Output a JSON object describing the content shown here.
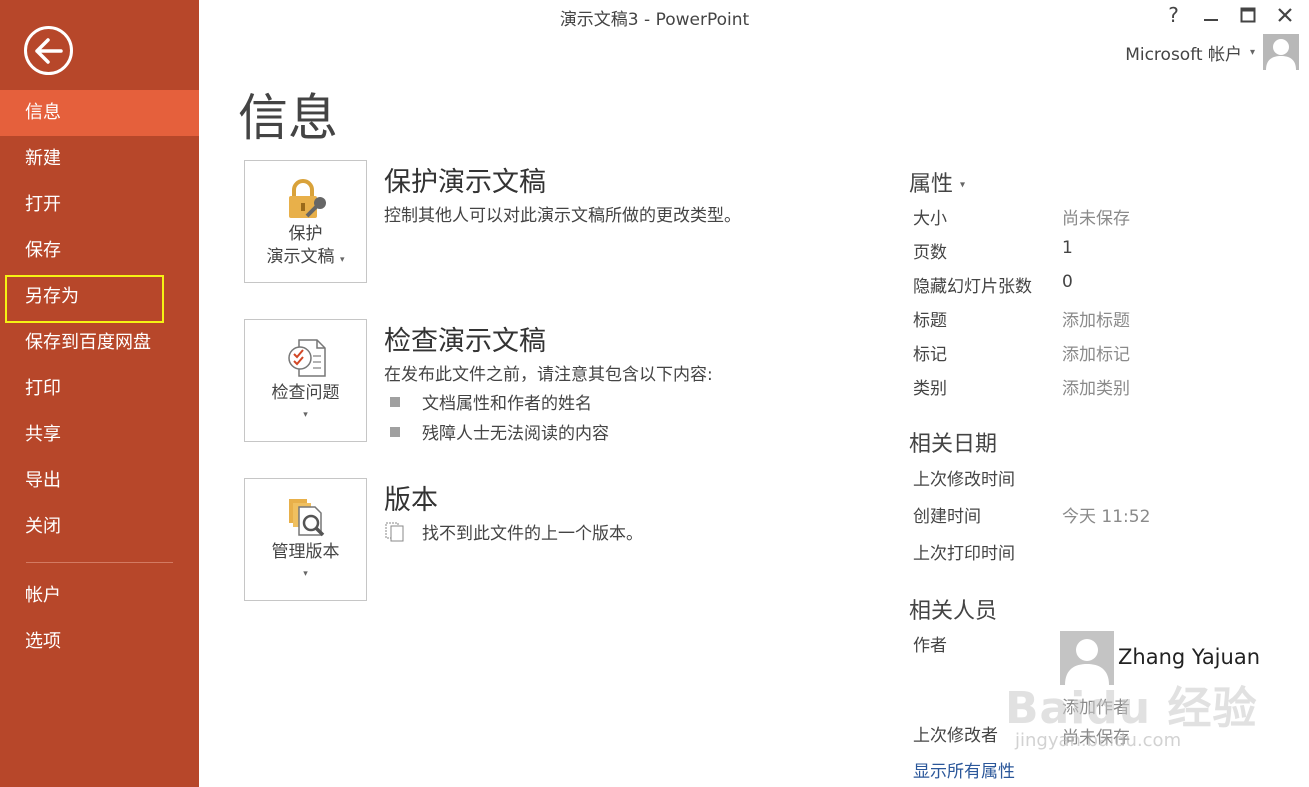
{
  "window": {
    "title": "演示文稿3 - PowerPoint",
    "help": "?",
    "minimize": "—",
    "maximize": "☐",
    "close": "✕"
  },
  "account": {
    "label": "Microsoft 帐户",
    "caret": "▾"
  },
  "sidebar": {
    "items": [
      {
        "label": "信息"
      },
      {
        "label": "新建"
      },
      {
        "label": "打开"
      },
      {
        "label": "保存"
      },
      {
        "label": "另存为"
      },
      {
        "label": "保存到百度网盘"
      },
      {
        "label": "打印"
      },
      {
        "label": "共享"
      },
      {
        "label": "导出"
      },
      {
        "label": "关闭"
      },
      {
        "label": "帐户"
      },
      {
        "label": "选项"
      }
    ],
    "active_index": 0,
    "highlighted_index": 4
  },
  "page": {
    "title": "信息"
  },
  "sections": {
    "protect": {
      "button_line1": "保护",
      "button_line2": "演示文稿",
      "caret": "▾",
      "title": "保护演示文稿",
      "desc": "控制其他人可以对此演示文稿所做的更改类型。"
    },
    "inspect": {
      "button_label": "检查问题",
      "caret": "▾",
      "title": "检查演示文稿",
      "desc": "在发布此文件之前，请注意其包含以下内容:",
      "bullets": [
        "文档属性和作者的姓名",
        "残障人士无法阅读的内容"
      ]
    },
    "versions": {
      "button_label": "管理版本",
      "caret": "▾",
      "title": "版本",
      "desc": "找不到此文件的上一个版本。"
    }
  },
  "properties": {
    "heading": "属性",
    "caret": "▾",
    "rows": [
      {
        "label": "大小",
        "value": "尚未保存"
      },
      {
        "label": "页数",
        "value": "1"
      },
      {
        "label": "隐藏幻灯片张数",
        "value": "0"
      },
      {
        "label": "标题",
        "value": "添加标题"
      },
      {
        "label": "标记",
        "value": "添加标记"
      },
      {
        "label": "类别",
        "value": "添加类别"
      }
    ],
    "dates_heading": "相关日期",
    "dates": [
      {
        "label": "上次修改时间",
        "value": ""
      },
      {
        "label": "创建时间",
        "value": "今天 11:52"
      },
      {
        "label": "上次打印时间",
        "value": ""
      }
    ],
    "people_heading": "相关人员",
    "author_label": "作者",
    "author_name": "Zhang Yajuan",
    "add_author": "添加作者",
    "last_modified_by_label": "上次修改者",
    "last_modified_by_value": "尚未保存",
    "show_all": "显示所有属性"
  },
  "watermark": {
    "text": "Baidu 经验",
    "sub": "jingyan.baidu.com"
  },
  "colors": {
    "sidebar": "#b7472a",
    "active": "#e5603c",
    "highlight": "#f5f214",
    "link": "#2b579a"
  }
}
